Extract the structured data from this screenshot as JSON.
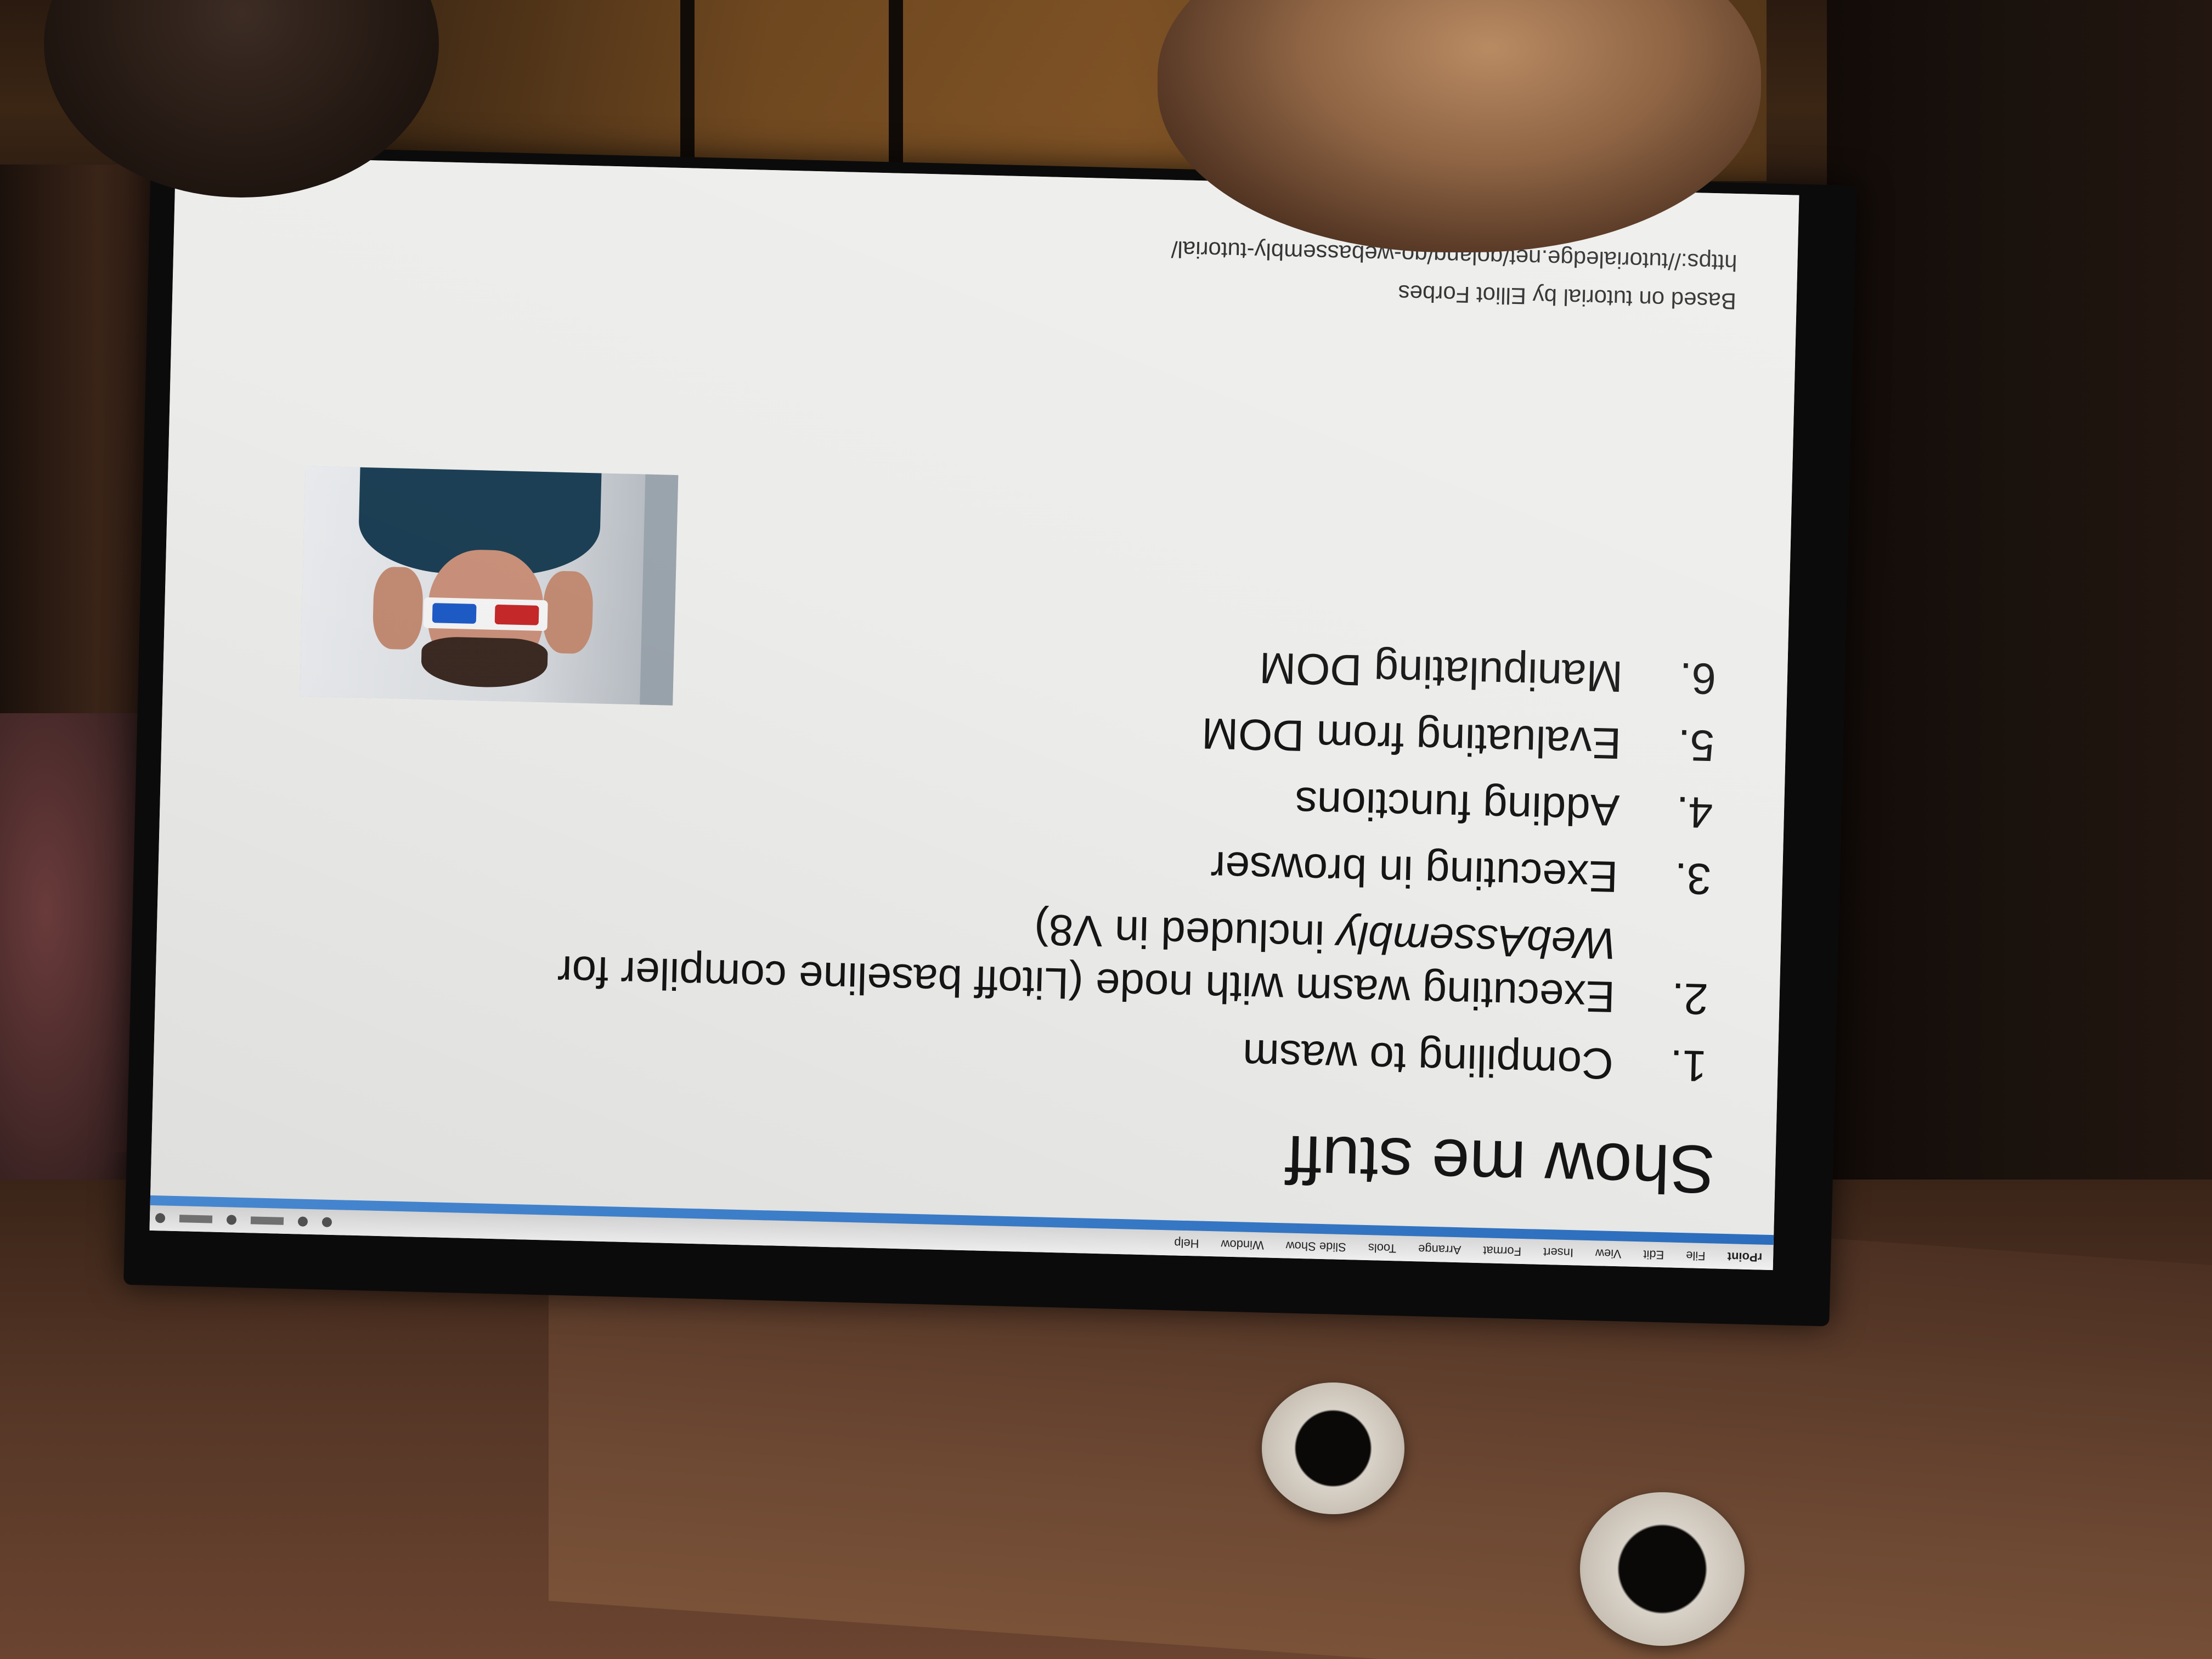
{
  "slide": {
    "title": "Show me stuff",
    "items": [
      {
        "num": "1.",
        "parts": [
          {
            "text": "Compiling to wasm",
            "italic": false
          }
        ]
      },
      {
        "num": "2.",
        "parts": [
          {
            "text": "Executing wasm with node (Litoff baseline compiler for ",
            "italic": false
          },
          {
            "text": "WebAssembly",
            "italic": true
          },
          {
            "text": " included in V8)",
            "italic": false
          }
        ]
      },
      {
        "num": "3.",
        "parts": [
          {
            "text": "Executing in browser",
            "italic": false
          }
        ]
      },
      {
        "num": "4.",
        "parts": [
          {
            "text": "Adding functions",
            "italic": false
          }
        ]
      },
      {
        "num": "5.",
        "parts": [
          {
            "text": "Evaluating from DOM",
            "italic": false
          }
        ]
      },
      {
        "num": "6.",
        "parts": [
          {
            "text": "Manipulating DOM",
            "italic": false
          }
        ]
      }
    ],
    "credit": "Based on tutorial by Elliot Forbes",
    "credit_url": "https://tutorialedge.net/golang/go-webassembly-tutorial/"
  },
  "menubar": {
    "app": "rPoint",
    "items": [
      "File",
      "Edit",
      "View",
      "Insert",
      "Format",
      "Arrange",
      "Tools",
      "Slide Show",
      "Window",
      "Help"
    ]
  },
  "colors": {
    "accent_strip": "#2c6fc0",
    "slide_bg": "#ececea",
    "text": "#151515"
  },
  "icons": {
    "glasses": "3d-glasses-icon"
  }
}
